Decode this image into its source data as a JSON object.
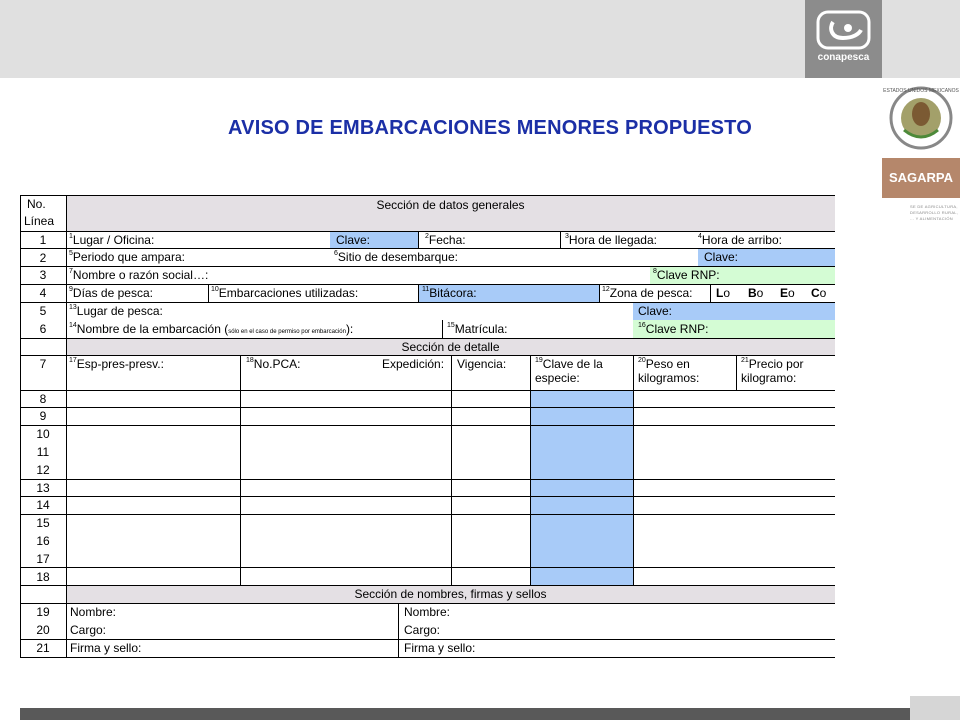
{
  "logo": {
    "name": "conapesca"
  },
  "side": {
    "brand": "SAGARPA",
    "emblem_text": "ESTADOS UNIDOS MEXICANOS",
    "ministry": "SE DE AGRICULTURA, DESARROLLO RURAL, ... Y ALIMENTACIÓN"
  },
  "title": "AVISO DE EMBARCACIONES MENORES PROPUESTO",
  "form": {
    "header_no": "No.",
    "header_linea": "Línea",
    "section_general": "Sección de datos generales",
    "section_detail": "Sección de detalle",
    "section_signatures": "Sección de nombres, firmas y sellos",
    "lines": [
      "1",
      "2",
      "3",
      "4",
      "5",
      "6",
      "7",
      "8",
      "9",
      "10",
      "11",
      "12",
      "13",
      "14",
      "15",
      "16",
      "17",
      "18",
      "19",
      "20",
      "21"
    ],
    "r1": {
      "lugar": "Lugar / Oficina:",
      "clave": "Clave:",
      "fecha": "Fecha:",
      "hora_llegada": "Hora de llegada:",
      "hora_arribo": "Hora de arribo:"
    },
    "r2": {
      "periodo": "Periodo que ampara:",
      "sitio": "Sitio de desembarque:",
      "clave": "Clave:"
    },
    "r3": {
      "nombre": "Nombre o razón social…:",
      "clave_rnp": "Clave RNP:"
    },
    "r4": {
      "dias": "Días de pesca:",
      "embarcaciones": "Embarcaciones utilizadas:",
      "bitacora": "Bitácora:",
      "zona": "Zona de pesca:",
      "zones": [
        "L",
        "B",
        "E",
        "C"
      ],
      "circle": "o"
    },
    "r5": {
      "lugar_pesca": "Lugar de pesca:",
      "clave": "Clave:"
    },
    "r6": {
      "nombre_emb": "Nombre de la embarcación (",
      "nota": "sólo en el caso de permiso por embarcación",
      "close": "):",
      "matricula": "Matrícula:",
      "clave_rnp": "Clave RNP:"
    },
    "r7": {
      "esp": "Esp-pres-presv.:",
      "pca": "No.PCA:",
      "expedicion": "Expedición:",
      "vigencia": "Vigencia:",
      "clave_especie": "Clave de la especie:",
      "peso": "Peso en kilogramos:",
      "precio": "Precio por kilogramo:"
    },
    "sig": {
      "nombre": "Nombre:",
      "cargo": "Cargo:",
      "firma": "Firma y sello:"
    },
    "sup": {
      "s1": "1",
      "s2": "2",
      "s3": "3",
      "s4": "4",
      "s5": "5",
      "s6": "6",
      "s7": "7",
      "s8": "8",
      "s9": "9",
      "s10": "10",
      "s11": "11",
      "s12": "12",
      "s13": "13",
      "s14": "14",
      "s15": "15",
      "s16": "16",
      "s17": "17",
      "s18": "18",
      "s19": "19",
      "s20": "20",
      "s21": "21"
    }
  },
  "colors": {
    "blue_cell": "#a8cbf8",
    "green_cell": "#d4fcd4",
    "gray_cell": "#e4e0e4",
    "title": "#1b2fa6"
  }
}
